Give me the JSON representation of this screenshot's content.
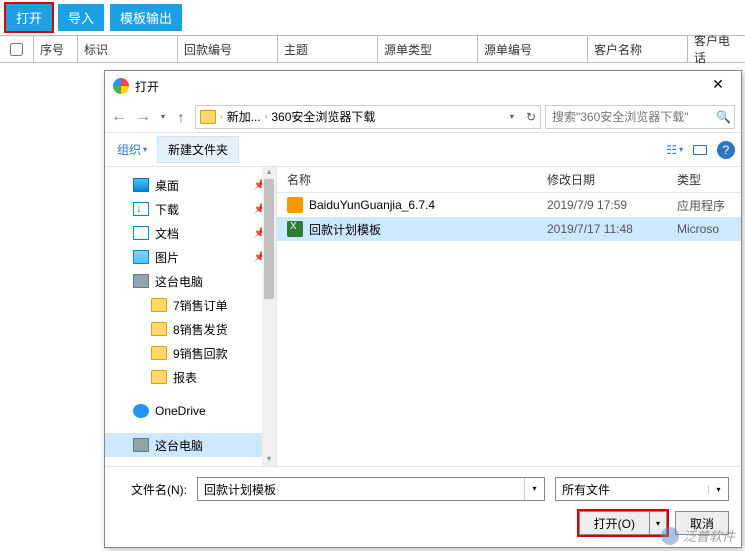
{
  "toolbar": {
    "open": "打开",
    "import": "导入",
    "export": "模板输出"
  },
  "grid": {
    "seq": "序号",
    "mark": "标识",
    "code": "回款编号",
    "subject": "主题",
    "source_type": "源单类型",
    "source_num": "源单编号",
    "customer": "客户名称",
    "phone": "客户电话"
  },
  "dialog": {
    "title": "打开",
    "breadcrumb": {
      "b1": "新加...",
      "b2": "360安全浏览器下载"
    },
    "search_placeholder": "搜索\"360安全浏览器下载\"",
    "organize": "组织",
    "new_folder": "新建文件夹",
    "sidebar": {
      "desktop": "桌面",
      "downloads": "下载",
      "documents": "文档",
      "pictures": "图片",
      "this_pc": "这台电脑",
      "f1": "7销售订单",
      "f2": "8销售发货",
      "f3": "9销售回款",
      "f4": "报表",
      "onedrive": "OneDrive",
      "this_pc2": "这台电脑"
    },
    "cols": {
      "name": "名称",
      "date": "修改日期",
      "type": "类型"
    },
    "files": [
      {
        "name": "BaiduYunGuanjia_6.7.4",
        "date": "2019/7/9 17:59",
        "type": "应用程序",
        "icon": "exe",
        "selected": false
      },
      {
        "name": "回款计划模板",
        "date": "2019/7/17 11:48",
        "type": "Microso",
        "icon": "xls",
        "selected": true
      }
    ],
    "filename_label": "文件名(N):",
    "filename_value": "回款计划模板",
    "filter_label": "所有文件",
    "open_btn": "打开(O)",
    "cancel_btn": "取消"
  },
  "watermark": "泛普软件"
}
